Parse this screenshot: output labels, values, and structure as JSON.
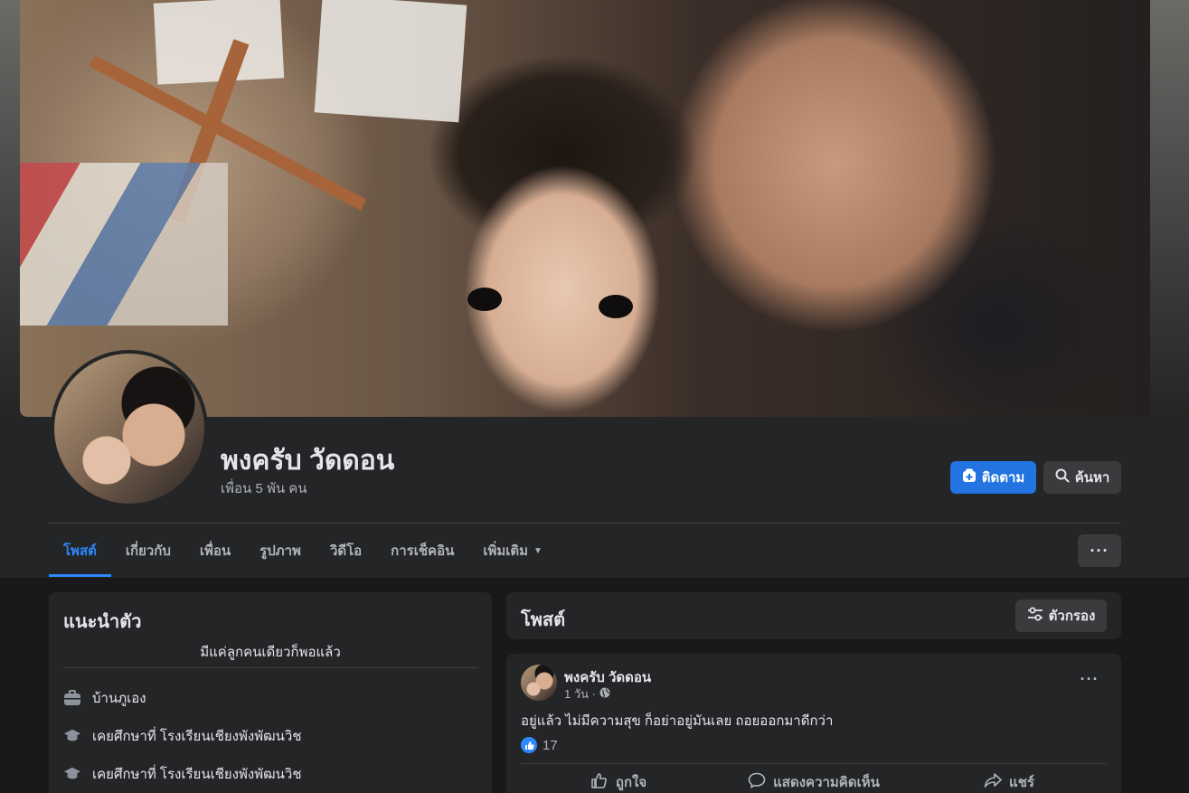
{
  "profile": {
    "name": "พงครับ วัดดอน",
    "friends": "เพื่อน 5 พัน คน",
    "follow_label": "ติดตาม",
    "search_label": "ค้นหา"
  },
  "tabs": [
    {
      "label": "โพสต์",
      "active": true
    },
    {
      "label": "เกี่ยวกับ"
    },
    {
      "label": "เพื่อน"
    },
    {
      "label": "รูปภาพ"
    },
    {
      "label": "วิดีโอ"
    },
    {
      "label": "การเช็คอิน"
    },
    {
      "label": "เพิ่มเติม"
    }
  ],
  "more_options": "···",
  "intro": {
    "title": "แนะนำตัว",
    "bio": "มีแค่ลูกคนเดียวก็พอแล้ว",
    "items": [
      {
        "icon": "briefcase-icon",
        "text": "บ้านภูเอง"
      },
      {
        "icon": "graduation-cap-icon",
        "text": "เคยศึกษาที่ โรงเรียนเชียงพังพัฒนวิช"
      },
      {
        "icon": "graduation-cap-icon",
        "text": "เคยศึกษาที่ โรงเรียนเชียงพังพัฒนวิช"
      }
    ]
  },
  "posts_header": {
    "title": "โพสต์",
    "filter_label": "ตัวกรอง"
  },
  "post": {
    "author": "พงครับ วัดดอน",
    "time": "1 วัน ·",
    "privacy_icon": "globe-icon",
    "text": "อยู่แล้ว ไม่มีความสุข ก็อย่าอยู่มันเลย ถอยออกมาดีกว่า",
    "like_count": "17",
    "options": "···",
    "actions": {
      "like": "ถูกใจ",
      "comment": "แสดงความคิดเห็น",
      "share": "แชร์"
    }
  },
  "colors": {
    "accent": "#2d88ff",
    "follow_button": "#2374e1",
    "card_bg": "#242526",
    "page_bg": "#18191a"
  }
}
